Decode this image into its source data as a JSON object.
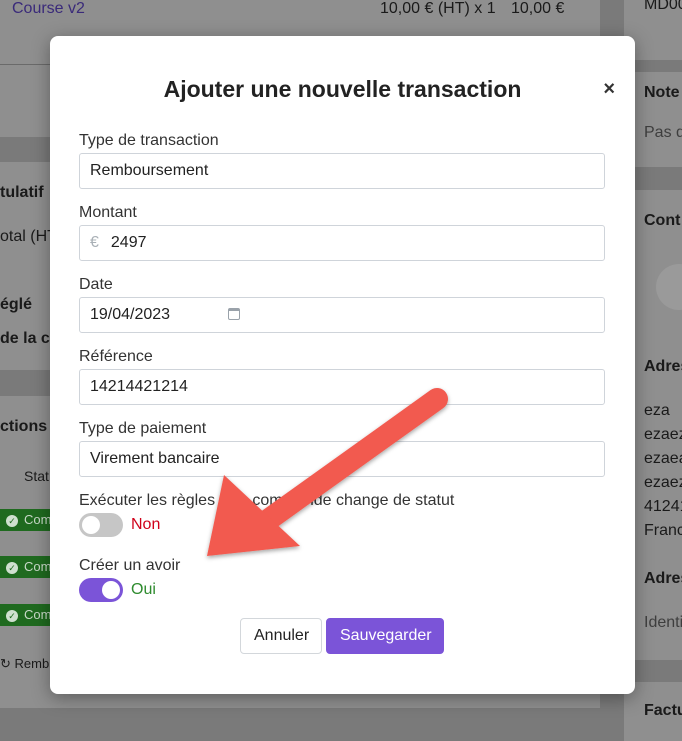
{
  "background": {
    "course_name": "Course v2",
    "course_price": "10,00 € (HT) x 1",
    "course_total": "10,00 €",
    "ref_code": "MD00",
    "notes_title": "Note",
    "notes_empty": "Pas d",
    "recap_title": "tulatif",
    "recap_total": "otal (HT",
    "regle": "églé",
    "de_la": "de la c",
    "transactions_title": "ctions",
    "status_header": "Stat",
    "status_pills": [
      "Com",
      "Com",
      "Com"
    ],
    "remb_label": "Remb",
    "contact_title": "Cont",
    "address_title": "Adres",
    "address_lines": [
      "eza",
      "ezaez",
      "ezaea",
      "ezaez",
      "41241",
      "Franc"
    ],
    "address2_title": "Adres",
    "ident_placeholder": "Identi",
    "facture_title": "Factu"
  },
  "modal": {
    "title": "Ajouter une nouvelle transaction",
    "close_symbol": "×",
    "fields": {
      "type_label": "Type de transaction",
      "type_value": "Remboursement",
      "amount_label": "Montant",
      "amount_currency": "€",
      "amount_value": "2497",
      "date_label": "Date",
      "date_value": "19/04/2023",
      "reference_label": "Référence",
      "reference_value": "14214421214",
      "payment_label": "Type de paiement",
      "payment_value": "Virement bancaire"
    },
    "rules": {
      "label": "Exécuter les règles si le commande change de statut",
      "state_text": "Non",
      "state_color": "#d0021b"
    },
    "credit": {
      "label": "Créer un avoir",
      "state_text": "Oui",
      "state_color": "#2e8b2e"
    },
    "buttons": {
      "cancel": "Annuler",
      "save": "Sauvegarder"
    }
  },
  "colors": {
    "accent": "#7b54d8",
    "arrow": "#f25a4f"
  }
}
